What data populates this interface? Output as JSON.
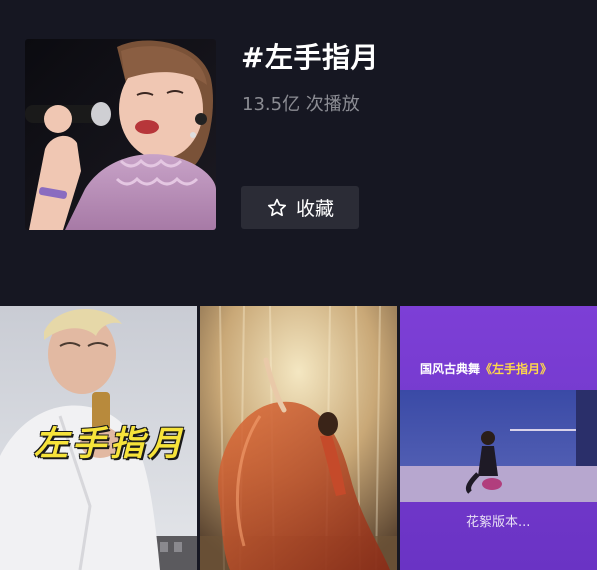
{
  "topic": {
    "title": "#左手指月",
    "plays": "13.5亿 次播放",
    "favorite_label": "收藏",
    "favorite_icon": "star-outline-icon"
  },
  "videos": [
    {
      "overlay_text": "左手指月"
    },
    {
      "overlay_text": ""
    },
    {
      "overlay_title_prefix": "国风古典舞",
      "overlay_title_accent": "《左手指月》",
      "caption": "花絮版本..."
    }
  ],
  "colors": {
    "background": "#161722",
    "button_bg": "#2b2c36",
    "secondary_text": "#8b8c93",
    "accent_yellow": "#f6e33a"
  }
}
